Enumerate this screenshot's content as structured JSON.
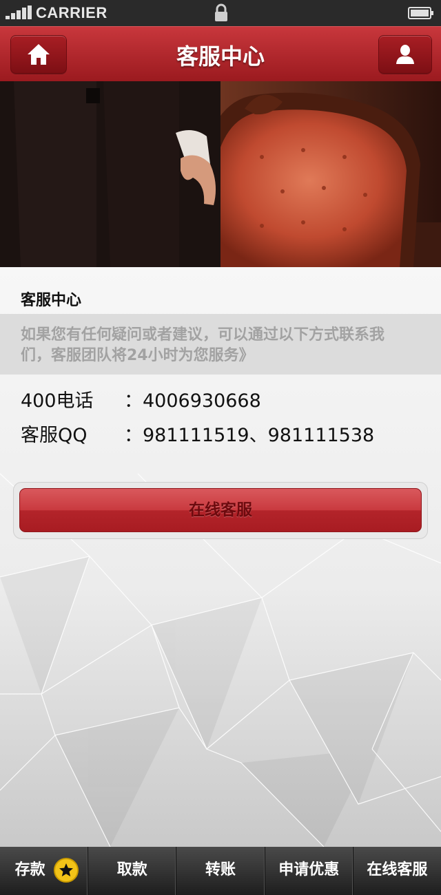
{
  "status_bar": {
    "carrier": "CARRIER"
  },
  "header": {
    "title": "客服中心"
  },
  "content": {
    "section_title": "客服中心",
    "notice": "如果您有任何疑问或者建议，可以通过以下方式联系我们，客服团队将24小时为您服务》",
    "contacts": [
      {
        "label": "400电话",
        "value": "：4006930668"
      },
      {
        "label": "客服QQ",
        "value": "：981111519、981111538"
      }
    ],
    "online_button": "在线客服"
  },
  "bottom_nav": {
    "items": [
      {
        "label": "存款",
        "icon": "star-icon"
      },
      {
        "label": "取款"
      },
      {
        "label": "转账"
      },
      {
        "label": "申请优惠"
      },
      {
        "label": "在线客服"
      }
    ]
  },
  "colors": {
    "brand_red": "#b8272c",
    "badge_yellow": "#f2c318"
  }
}
